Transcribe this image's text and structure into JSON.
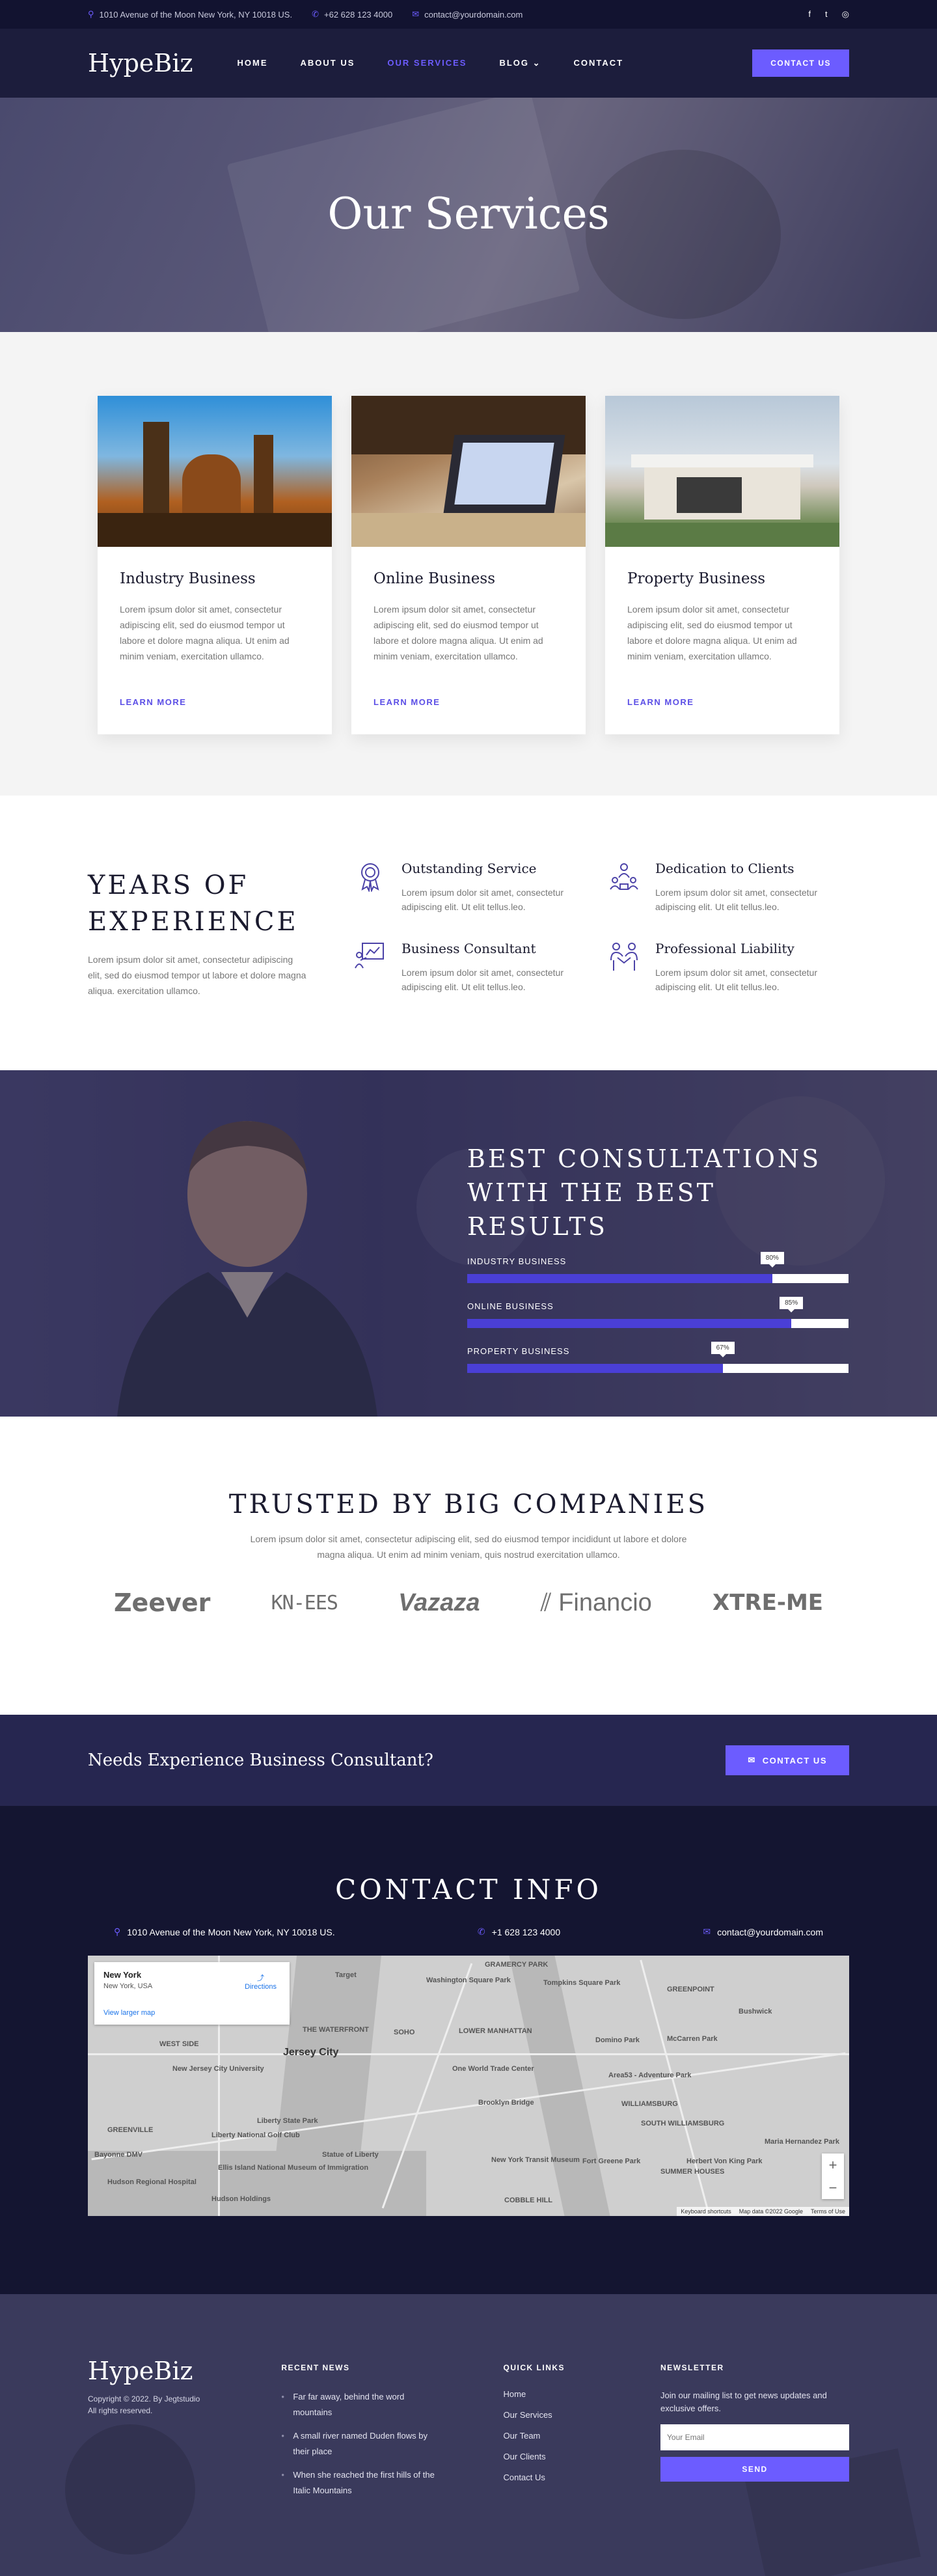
{
  "topbar": {
    "address": "1010 Avenue of the Moon New York, NY 10018 US.",
    "phone": "+62 628 123 4000",
    "email": "contact@yourdomain.com",
    "social": [
      "f",
      "t",
      "◎"
    ]
  },
  "header": {
    "logo": "HypeBiz",
    "nav": [
      "HOME",
      "ABOUT US",
      "OUR SERVICES",
      "BLOG",
      "CONTACT"
    ],
    "blog_caret": "⌄",
    "cta": "CONTACT US"
  },
  "hero": {
    "title": "Our Services"
  },
  "services": [
    {
      "title": "Industry Business",
      "text": "Lorem ipsum dolor sit amet, consectetur adipiscing elit, sed do eiusmod tempor ut labore et dolore magna aliqua. Ut enim ad minim veniam, exercitation ullamco.",
      "link": "LEARN MORE"
    },
    {
      "title": "Online Business",
      "text": "Lorem ipsum dolor sit amet, consectetur adipiscing elit, sed do eiusmod tempor ut labore et dolore magna aliqua. Ut enim ad minim veniam, exercitation ullamco.",
      "link": "LEARN MORE"
    },
    {
      "title": "Property Business",
      "text": "Lorem ipsum dolor sit amet, consectetur adipiscing elit, sed do eiusmod tempor ut labore et dolore magna aliqua. Ut enim ad minim veniam, exercitation ullamco.",
      "link": "LEARN MORE"
    }
  ],
  "experience": {
    "title_line1": "YEARS OF",
    "title_line2": "EXPERIENCE",
    "text": "Lorem ipsum dolor sit amet, consectetur adipiscing elit, sed do eiusmod tempor ut labore et dolore magna aliqua. exercitation ullamco.",
    "features": [
      {
        "title": "Outstanding Service",
        "text": "Lorem ipsum dolor sit amet, consectetur adipiscing elit. Ut elit tellus.leo.",
        "icon": "award-icon"
      },
      {
        "title": "Dedication to Clients",
        "text": "Lorem ipsum dolor sit amet, consectetur adipiscing elit. Ut elit tellus.leo.",
        "icon": "team-icon"
      },
      {
        "title": "Business Consultant",
        "text": "Lorem ipsum dolor sit amet, consectetur adipiscing elit. Ut elit tellus.leo.",
        "icon": "presentation-icon"
      },
      {
        "title": "Professional Liability",
        "text": "Lorem ipsum dolor sit amet, consectetur adipiscing elit. Ut elit tellus.leo.",
        "icon": "handshake-icon"
      }
    ]
  },
  "consult": {
    "title_line1": "BEST CONSULTATIONS",
    "title_line2": "WITH THE BEST RESULTS",
    "bars": [
      {
        "label": "INDUSTRY BUSINESS",
        "value": 80,
        "display": "80%"
      },
      {
        "label": "ONLINE BUSINESS",
        "value": 85,
        "display": "85%"
      },
      {
        "label": "PROPERTY BUSINESS",
        "value": 67,
        "display": "67%"
      }
    ]
  },
  "trusted": {
    "title": "TRUSTED BY BIG COMPANIES",
    "text": "Lorem ipsum dolor sit amet, consectetur adipiscing elit, sed do eiusmod tempor incididunt ut labore et dolore magna aliqua. Ut enim ad minim veniam, quis nostrud exercitation ullamco.",
    "logos": [
      "Zeever",
      "KN-EES",
      "Vazaza",
      "Financio",
      "XTRE-ME"
    ]
  },
  "cta": {
    "text": "Needs Experience Business Consultant?",
    "button": "CONTACT US"
  },
  "contact": {
    "title": "CONTACT INFO",
    "address": "1010 Avenue of the Moon New York, NY 10018 US.",
    "phone": "+1 628 123 4000",
    "email": "contact@yourdomain.com",
    "map": {
      "place": "New York",
      "place_sub": "New York, USA",
      "directions": "Directions",
      "larger": "View larger map",
      "zoom_in": "+",
      "zoom_out": "−",
      "labels": [
        "Target",
        "Washington Square Park",
        "Tompkins Square Park",
        "GREENPOINT",
        "GRAMERCY PARK",
        "WEST SIDE",
        "THE WATERFRONT",
        "LOWER MANHATTAN",
        "SOHO",
        "Jersey City",
        "New Jersey City University",
        "One World Trade Center",
        "Domino Park",
        "McCarren Park",
        "Area53 - Adventure Park",
        "Liberty State Park",
        "Brooklyn Bridge",
        "WILLIAMSBURG",
        "SOUTH WILLIAMSBURG",
        "GREENVILLE",
        "Bayonne DMV",
        "Liberty National Golf Club",
        "Statue of Liberty",
        "Ellis Island National Museum of Immigration",
        "New York Transit Museum",
        "Fort Greene Park",
        "Herbert Von King Park",
        "Maria Hernandez Park",
        "SUMMER HOUSES",
        "COBBLE HILL",
        "Hudson Regional Hospital",
        "Hudson Holdings",
        "Bushwick"
      ],
      "footer": [
        "Keyboard shortcuts",
        "Map data ©2022 Google",
        "Terms of Use"
      ]
    }
  },
  "footer": {
    "logo": "HypeBiz",
    "copy1": "Copyright © 2022. By Jegtstudio",
    "copy2": "All rights reserved.",
    "news_title": "RECENT NEWS",
    "news": [
      "Far far away, behind the word mountains",
      "A small river named Duden flows by their place",
      "When she reached the first hills of the Italic Mountains"
    ],
    "links_title": "QUICK LINKS",
    "links": [
      "Home",
      "Our Services",
      "Our Team",
      "Our Clients",
      "Contact Us"
    ],
    "nl_title": "NEWSLETTER",
    "nl_text": "Join our mailing list to get news updates and exclusive offers.",
    "nl_placeholder": "Your Email",
    "nl_button": "SEND"
  },
  "colors": {
    "accent": "#6c5cff",
    "dark": "#141531",
    "navy": "#1c1d3c"
  }
}
